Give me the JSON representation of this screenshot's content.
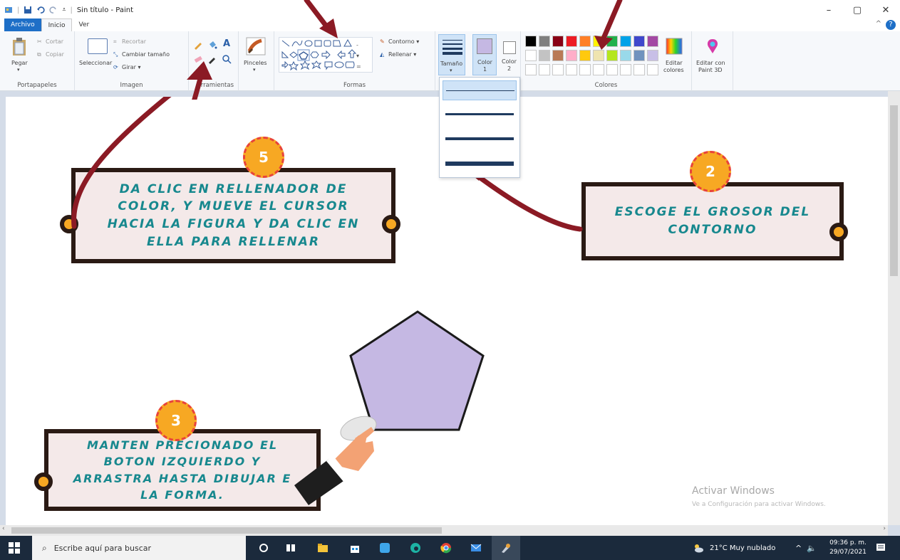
{
  "window": {
    "title": "Sin título - Paint",
    "min": "–",
    "max": "▢",
    "close": "✕"
  },
  "tabs": [
    {
      "label": "Archivo"
    },
    {
      "label": "Inicio"
    },
    {
      "label": "Ver"
    }
  ],
  "help": "?",
  "collapse": "^",
  "ribbon": {
    "portapapeles": {
      "label": "Portapapeles",
      "pegar": "Pegar",
      "cortar": "Cortar",
      "copiar": "Copiar"
    },
    "imagen": {
      "label": "Imagen",
      "seleccionar": "Seleccionar",
      "recortar": "Recortar",
      "cambiar_tamano": "Cambiar tamaño",
      "girar": "Girar ▾"
    },
    "herramientas": {
      "label": "rramientas"
    },
    "pinceles": {
      "label": "Pinceles"
    },
    "formas": {
      "label": "Formas",
      "contorno": "Contorno ▾",
      "rellenar": "Rellenar ▾"
    },
    "tamano": {
      "label": "Tamaño"
    },
    "color1": {
      "label": "Color",
      "num": "1",
      "color": "#c5b8e3"
    },
    "color2": {
      "label": "Color",
      "num": "2"
    },
    "colores": {
      "label": "Colores",
      "editar_colores_1": "Editar",
      "editar_colores_2": "colores",
      "palette_row1": [
        "#000000",
        "#7f7f7f",
        "#880015",
        "#ed1c24",
        "#ff7f27",
        "#fff200",
        "#22b14c",
        "#00a2e8",
        "#3f48cc",
        "#a349a4"
      ],
      "palette_row2": [
        "#ffffff",
        "#c3c3c3",
        "#b97a57",
        "#ffaec9",
        "#ffc90e",
        "#efe4b0",
        "#b5e61d",
        "#99d9ea",
        "#7092be",
        "#c8bfe7"
      ]
    },
    "paint3d": {
      "line1": "Editar con",
      "line2": "Paint 3D"
    }
  },
  "callouts": {
    "step5": {
      "badge": "5",
      "text": "DA CLIC EN  RELLENADOR DE COLOR, Y MUEVE EL CURSOR HACIA LA FIGURA Y DA CLIC EN ELLA PARA RELLENAR"
    },
    "step2": {
      "badge": "2",
      "text": "ESCOGE EL GROSOR DEL CONTORNO"
    },
    "step3": {
      "badge": "3",
      "text": "MANTEN PRECIONADO EL BOTON IZQUIERDO Y ARRASTRA HASTA DIBUJAR E LA FORMA."
    }
  },
  "shape": {
    "fill": "#c5b8e3",
    "stroke": "#1a1a1a"
  },
  "watermark": {
    "line1": "Activar Windows",
    "line2": "Ve a Configuración para activar Windows."
  },
  "taskbar": {
    "search_placeholder": "Escribe aquí para buscar",
    "weather": "21°C  Muy nublado",
    "time": "09:36 p. m.",
    "date": "29/07/2021"
  },
  "colors": {
    "accent": "#1e6fc7",
    "arrow": "#8b1a24",
    "callout_text": "#17888e",
    "knob": "#f7a823"
  }
}
